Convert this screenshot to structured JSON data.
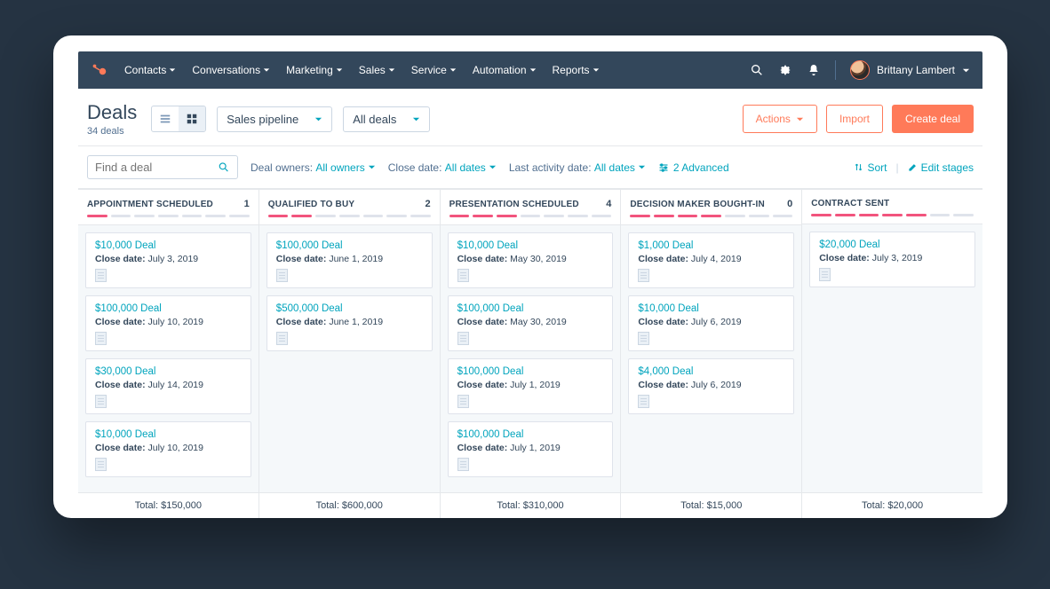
{
  "nav": {
    "items": [
      {
        "label": "Contacts"
      },
      {
        "label": "Conversations"
      },
      {
        "label": "Marketing"
      },
      {
        "label": "Sales"
      },
      {
        "label": "Service"
      },
      {
        "label": "Automation"
      },
      {
        "label": "Reports"
      }
    ],
    "user_name": "Brittany Lambert"
  },
  "header": {
    "title": "Deals",
    "count_label": "34 deals",
    "pipeline_select": "Sales pipeline",
    "scope_select": "All deals",
    "actions_label": "Actions",
    "import_label": "Import",
    "create_label": "Create deal"
  },
  "filters": {
    "search_placeholder": "Find a deal",
    "owner_label": "Deal owners:",
    "owner_value": "All owners",
    "close_label": "Close date:",
    "close_value": "All dates",
    "activity_label": "Last activity date:",
    "activity_value": "All dates",
    "advanced_label": "2 Advanced",
    "sort_label": "Sort",
    "edit_label": "Edit stages"
  },
  "columns": [
    {
      "title": "APPOINTMENT SCHEDULED",
      "count": "1",
      "progress": 1,
      "cards": [
        {
          "title": "$10,000 Deal",
          "close": "July 3, 2019"
        },
        {
          "title": "$100,000 Deal",
          "close": "July 10, 2019"
        },
        {
          "title": "$30,000 Deal",
          "close": "July 14, 2019"
        },
        {
          "title": "$10,000 Deal",
          "close": "July 10, 2019"
        }
      ],
      "total": "Total: $150,000"
    },
    {
      "title": "QUALIFIED TO BUY",
      "count": "2",
      "progress": 2,
      "cards": [
        {
          "title": "$100,000 Deal",
          "close": "June 1, 2019"
        },
        {
          "title": "$500,000 Deal",
          "close": "June 1, 2019"
        }
      ],
      "total": "Total: $600,000"
    },
    {
      "title": "PRESENTATION SCHEDULED",
      "count": "4",
      "progress": 3,
      "cards": [
        {
          "title": "$10,000 Deal",
          "close": "May 30, 2019"
        },
        {
          "title": "$100,000 Deal",
          "close": "May 30, 2019"
        },
        {
          "title": "$100,000 Deal",
          "close": "July 1, 2019"
        },
        {
          "title": "$100,000 Deal",
          "close": "July 1, 2019"
        }
      ],
      "total": "Total: $310,000"
    },
    {
      "title": "DECISION MAKER BOUGHT-IN",
      "count": "0",
      "progress": 4,
      "cards": [
        {
          "title": "$1,000 Deal",
          "close": "July 4, 2019"
        },
        {
          "title": "$10,000 Deal",
          "close": "July 6, 2019"
        },
        {
          "title": "$4,000 Deal",
          "close": "July 6, 2019"
        }
      ],
      "total": "Total: $15,000"
    },
    {
      "title": "CONTRACT SENT",
      "count": "",
      "progress": 5,
      "cards": [
        {
          "title": "$20,000 Deal",
          "close": "July 3, 2019"
        }
      ],
      "total": "Total: $20,000"
    }
  ],
  "labels": {
    "close_prefix": "Close date:"
  }
}
